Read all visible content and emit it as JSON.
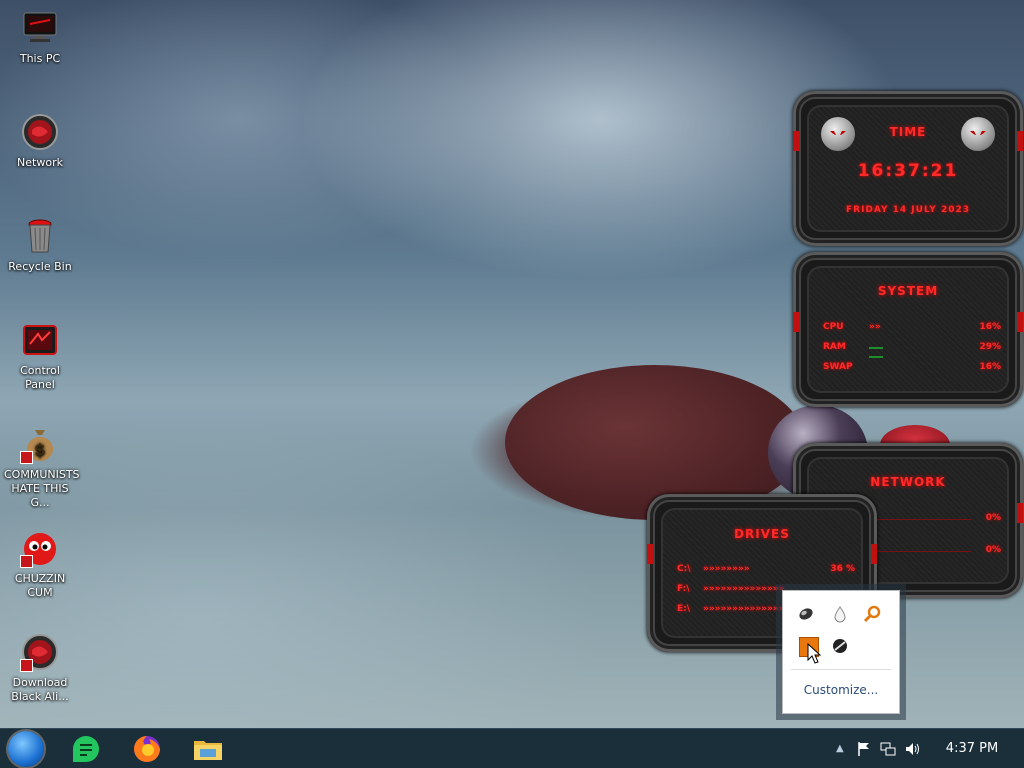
{
  "desktop_icons": [
    {
      "id": "this-pc",
      "label": "This PC"
    },
    {
      "id": "network",
      "label": "Network"
    },
    {
      "id": "recycle-bin",
      "label": "Recycle Bin"
    },
    {
      "id": "control-panel",
      "label": "Control Panel"
    },
    {
      "id": "communists",
      "label": "COMMUNISTS HATE THIS G..."
    },
    {
      "id": "chuzzin",
      "label": "CHUZZIN CUM"
    },
    {
      "id": "download",
      "label": "Download Black Ali..."
    }
  ],
  "time_widget": {
    "title": "TIME",
    "time": "16:37:21",
    "date": "FRIDAY 14 JULY 2023"
  },
  "system_widget": {
    "title": "SYSTEM",
    "rows": [
      {
        "label": "CPU",
        "value": "16%",
        "percent": 16
      },
      {
        "label": "RAM",
        "value": "29%",
        "percent": 29
      },
      {
        "label": "SWAP",
        "value": "16%",
        "percent": 16
      }
    ]
  },
  "network_widget": {
    "title": "NETWORK",
    "rows": [
      {
        "value": "0%"
      },
      {
        "value": "0%"
      }
    ]
  },
  "drives_widget": {
    "title": "DRIVES",
    "rows": [
      {
        "label": "C:\\",
        "value": "36 %"
      },
      {
        "label": "F:\\",
        "value": ""
      },
      {
        "label": "E:\\",
        "value": ""
      }
    ]
  },
  "tray_popup": {
    "customize_label": "Customize..."
  },
  "taskbar": {
    "clock": "4:37 PM"
  }
}
